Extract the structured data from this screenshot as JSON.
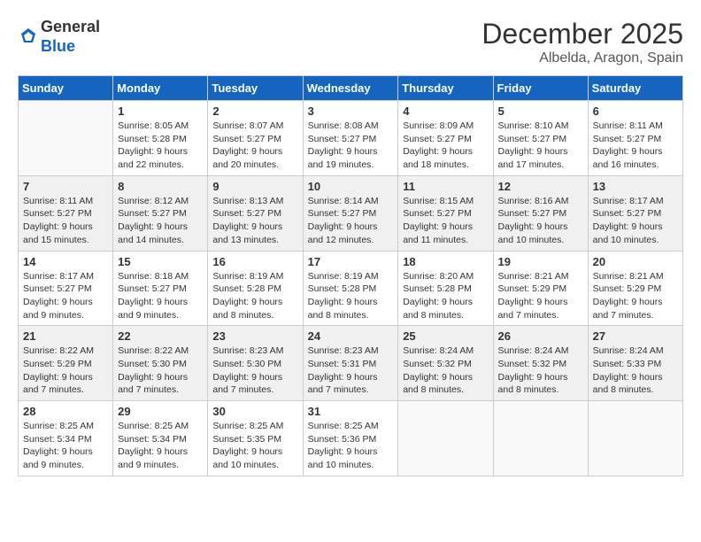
{
  "header": {
    "logo_line1": "General",
    "logo_line2": "Blue",
    "month": "December 2025",
    "location": "Albelda, Aragon, Spain"
  },
  "weekdays": [
    "Sunday",
    "Monday",
    "Tuesday",
    "Wednesday",
    "Thursday",
    "Friday",
    "Saturday"
  ],
  "weeks": [
    [
      {
        "day": "",
        "sunrise": "",
        "sunset": "",
        "daylight": ""
      },
      {
        "day": "1",
        "sunrise": "Sunrise: 8:05 AM",
        "sunset": "Sunset: 5:28 PM",
        "daylight": "Daylight: 9 hours and 22 minutes."
      },
      {
        "day": "2",
        "sunrise": "Sunrise: 8:07 AM",
        "sunset": "Sunset: 5:27 PM",
        "daylight": "Daylight: 9 hours and 20 minutes."
      },
      {
        "day": "3",
        "sunrise": "Sunrise: 8:08 AM",
        "sunset": "Sunset: 5:27 PM",
        "daylight": "Daylight: 9 hours and 19 minutes."
      },
      {
        "day": "4",
        "sunrise": "Sunrise: 8:09 AM",
        "sunset": "Sunset: 5:27 PM",
        "daylight": "Daylight: 9 hours and 18 minutes."
      },
      {
        "day": "5",
        "sunrise": "Sunrise: 8:10 AM",
        "sunset": "Sunset: 5:27 PM",
        "daylight": "Daylight: 9 hours and 17 minutes."
      },
      {
        "day": "6",
        "sunrise": "Sunrise: 8:11 AM",
        "sunset": "Sunset: 5:27 PM",
        "daylight": "Daylight: 9 hours and 16 minutes."
      }
    ],
    [
      {
        "day": "7",
        "sunrise": "Sunrise: 8:11 AM",
        "sunset": "Sunset: 5:27 PM",
        "daylight": "Daylight: 9 hours and 15 minutes."
      },
      {
        "day": "8",
        "sunrise": "Sunrise: 8:12 AM",
        "sunset": "Sunset: 5:27 PM",
        "daylight": "Daylight: 9 hours and 14 minutes."
      },
      {
        "day": "9",
        "sunrise": "Sunrise: 8:13 AM",
        "sunset": "Sunset: 5:27 PM",
        "daylight": "Daylight: 9 hours and 13 minutes."
      },
      {
        "day": "10",
        "sunrise": "Sunrise: 8:14 AM",
        "sunset": "Sunset: 5:27 PM",
        "daylight": "Daylight: 9 hours and 12 minutes."
      },
      {
        "day": "11",
        "sunrise": "Sunrise: 8:15 AM",
        "sunset": "Sunset: 5:27 PM",
        "daylight": "Daylight: 9 hours and 11 minutes."
      },
      {
        "day": "12",
        "sunrise": "Sunrise: 8:16 AM",
        "sunset": "Sunset: 5:27 PM",
        "daylight": "Daylight: 9 hours and 10 minutes."
      },
      {
        "day": "13",
        "sunrise": "Sunrise: 8:17 AM",
        "sunset": "Sunset: 5:27 PM",
        "daylight": "Daylight: 9 hours and 10 minutes."
      }
    ],
    [
      {
        "day": "14",
        "sunrise": "Sunrise: 8:17 AM",
        "sunset": "Sunset: 5:27 PM",
        "daylight": "Daylight: 9 hours and 9 minutes."
      },
      {
        "day": "15",
        "sunrise": "Sunrise: 8:18 AM",
        "sunset": "Sunset: 5:27 PM",
        "daylight": "Daylight: 9 hours and 9 minutes."
      },
      {
        "day": "16",
        "sunrise": "Sunrise: 8:19 AM",
        "sunset": "Sunset: 5:28 PM",
        "daylight": "Daylight: 9 hours and 8 minutes."
      },
      {
        "day": "17",
        "sunrise": "Sunrise: 8:19 AM",
        "sunset": "Sunset: 5:28 PM",
        "daylight": "Daylight: 9 hours and 8 minutes."
      },
      {
        "day": "18",
        "sunrise": "Sunrise: 8:20 AM",
        "sunset": "Sunset: 5:28 PM",
        "daylight": "Daylight: 9 hours and 8 minutes."
      },
      {
        "day": "19",
        "sunrise": "Sunrise: 8:21 AM",
        "sunset": "Sunset: 5:29 PM",
        "daylight": "Daylight: 9 hours and 7 minutes."
      },
      {
        "day": "20",
        "sunrise": "Sunrise: 8:21 AM",
        "sunset": "Sunset: 5:29 PM",
        "daylight": "Daylight: 9 hours and 7 minutes."
      }
    ],
    [
      {
        "day": "21",
        "sunrise": "Sunrise: 8:22 AM",
        "sunset": "Sunset: 5:29 PM",
        "daylight": "Daylight: 9 hours and 7 minutes."
      },
      {
        "day": "22",
        "sunrise": "Sunrise: 8:22 AM",
        "sunset": "Sunset: 5:30 PM",
        "daylight": "Daylight: 9 hours and 7 minutes."
      },
      {
        "day": "23",
        "sunrise": "Sunrise: 8:23 AM",
        "sunset": "Sunset: 5:30 PM",
        "daylight": "Daylight: 9 hours and 7 minutes."
      },
      {
        "day": "24",
        "sunrise": "Sunrise: 8:23 AM",
        "sunset": "Sunset: 5:31 PM",
        "daylight": "Daylight: 9 hours and 7 minutes."
      },
      {
        "day": "25",
        "sunrise": "Sunrise: 8:24 AM",
        "sunset": "Sunset: 5:32 PM",
        "daylight": "Daylight: 9 hours and 8 minutes."
      },
      {
        "day": "26",
        "sunrise": "Sunrise: 8:24 AM",
        "sunset": "Sunset: 5:32 PM",
        "daylight": "Daylight: 9 hours and 8 minutes."
      },
      {
        "day": "27",
        "sunrise": "Sunrise: 8:24 AM",
        "sunset": "Sunset: 5:33 PM",
        "daylight": "Daylight: 9 hours and 8 minutes."
      }
    ],
    [
      {
        "day": "28",
        "sunrise": "Sunrise: 8:25 AM",
        "sunset": "Sunset: 5:34 PM",
        "daylight": "Daylight: 9 hours and 9 minutes."
      },
      {
        "day": "29",
        "sunrise": "Sunrise: 8:25 AM",
        "sunset": "Sunset: 5:34 PM",
        "daylight": "Daylight: 9 hours and 9 minutes."
      },
      {
        "day": "30",
        "sunrise": "Sunrise: 8:25 AM",
        "sunset": "Sunset: 5:35 PM",
        "daylight": "Daylight: 9 hours and 10 minutes."
      },
      {
        "day": "31",
        "sunrise": "Sunrise: 8:25 AM",
        "sunset": "Sunset: 5:36 PM",
        "daylight": "Daylight: 9 hours and 10 minutes."
      },
      {
        "day": "",
        "sunrise": "",
        "sunset": "",
        "daylight": ""
      },
      {
        "day": "",
        "sunrise": "",
        "sunset": "",
        "daylight": ""
      },
      {
        "day": "",
        "sunrise": "",
        "sunset": "",
        "daylight": ""
      }
    ]
  ]
}
